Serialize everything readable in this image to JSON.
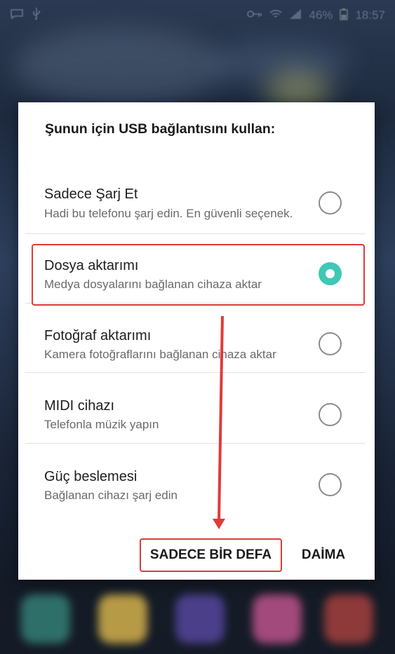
{
  "status_bar": {
    "battery_percent": "46%",
    "time": "18:57",
    "left_icons": [
      "message-icon",
      "usb-icon"
    ],
    "right_icons": [
      "key-icon",
      "wifi-icon",
      "signal-icon",
      "battery-icon"
    ]
  },
  "dialog": {
    "title": "Şunun için USB bağlantısını kullan:",
    "options": [
      {
        "title": "Sadece Şarj Et",
        "subtitle": "Hadi bu telefonu şarj edin. En güvenli seçenek.",
        "selected": false
      },
      {
        "title": "Dosya aktarımı",
        "subtitle": "Medya dosyalarını bağlanan cihaza aktar",
        "selected": true
      },
      {
        "title": "Fotoğraf aktarımı",
        "subtitle": "Kamera fotoğraflarını bağlanan cihaza aktar",
        "selected": false
      },
      {
        "title": "MIDI cihazı",
        "subtitle": "Telefonla müzik yapın",
        "selected": false
      },
      {
        "title": "Güç beslemesi",
        "subtitle": "Bağlanan cihazı şarj edin",
        "selected": false
      }
    ],
    "buttons": {
      "once": "SADECE BİR DEFA",
      "always": "DAİMA"
    }
  },
  "colors": {
    "accent": "#3fc8b6",
    "annotation": "#e03a3a"
  }
}
